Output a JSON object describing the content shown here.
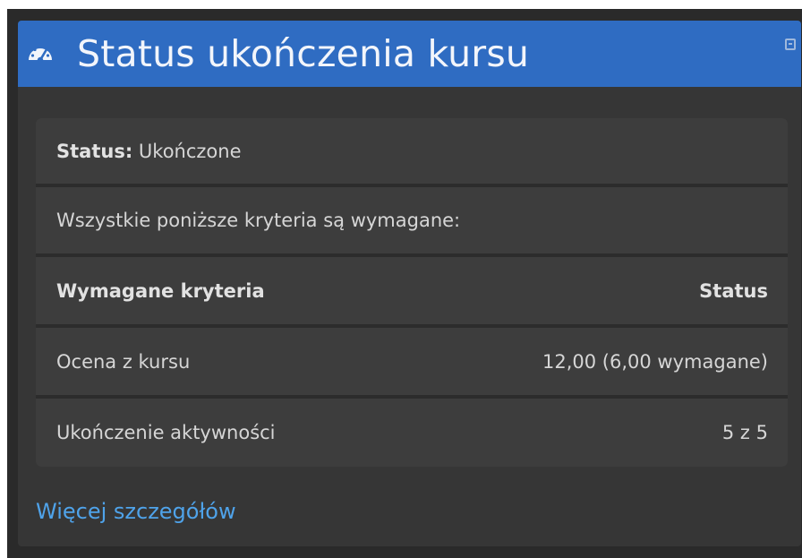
{
  "block": {
    "title": "Status ukończenia kursu",
    "header_color": "#2f6cc2",
    "icon": "dashboard-gauge-icon",
    "collapse_icon": "collapse-minus-icon"
  },
  "status": {
    "label": "Status:",
    "value": "Ukończone"
  },
  "requirement_note": "Wszystkie poniższe kryteria są wymagane:",
  "table": {
    "header_left": "Wymagane kryteria",
    "header_right": "Status",
    "rows": [
      {
        "criterion": "Ocena z kursu",
        "status": "12,00 (6,00 wymagane)"
      },
      {
        "criterion": "Ukończenie aktywności",
        "status": "5 z 5"
      }
    ]
  },
  "more_details_link": "Więcej szczegółów",
  "link_color": "#4fa3ea"
}
